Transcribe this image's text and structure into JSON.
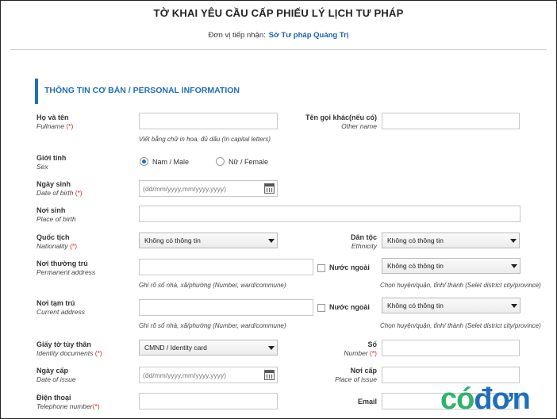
{
  "header": {
    "title": "TỜ KHAI YÊU CẦU CẤP PHIẾU LÝ LỊCH TƯ PHÁP",
    "unit_label": "Đơn vị tiếp nhận:",
    "unit_value": "Sở Tư pháp Quảng Trị"
  },
  "section": {
    "title": "THÔNG TIN CƠ BẢN / PERSONAL INFORMATION"
  },
  "fullname": {
    "label": "Họ và tên",
    "sub": "Fullname",
    "req": "(*)",
    "hint": "Viết bằng chữ in hoa, đủ dấu (In capital letters)"
  },
  "other_name": {
    "label": "Tên gọi khác(nếu có)",
    "sub": "Other name"
  },
  "sex": {
    "label": "Giới tính",
    "sub": "Sex",
    "male": "Nam / Male",
    "female": "Nữ / Female",
    "selected": "male"
  },
  "dob": {
    "label": "Ngày sinh",
    "sub": "Date of birth",
    "req": "(*)",
    "placeholder": "(dd/mm/yyyy,mm/yyyy,yyyy)"
  },
  "pob": {
    "label": "Nơi sinh",
    "sub": "Place of birth"
  },
  "nationality": {
    "label": "Quốc tịch",
    "sub": "Nationality",
    "req": "(*)",
    "value": "Không có thông tin"
  },
  "ethnicity": {
    "label": "Dân tộc",
    "sub": "Ethnicity",
    "value": "Không có thông tin"
  },
  "permanent": {
    "label": "Nơi thường trú",
    "sub": "Permanent address",
    "foreign": "Nước ngoài",
    "select": "Không có thông tin",
    "hint_left": "Ghi rõ số nhà, xã/phường (Number, ward/commune)",
    "hint_right": "Chọn huyện/quận, tỉnh/ thành (Selet district city/province)"
  },
  "current": {
    "label": "Nơi tạm trú",
    "sub": "Current address",
    "foreign": "Nước ngoài",
    "select": "Không có thông tin",
    "hint_left": "Ghi rõ số nhà, xã/phường (Number, ward/commune)",
    "hint_right": "Chọn huyện/quận, tỉnh/ thành (Selet district city/province)"
  },
  "id_doc": {
    "label": "Giấy tờ tùy thân",
    "sub": "Identity documents",
    "req": "(*)",
    "value": "CMND / Identity card"
  },
  "number": {
    "label": "Số",
    "sub": "Number",
    "req": "(*)"
  },
  "issue_date": {
    "label": "Ngày cấp",
    "sub": "Date of issue",
    "placeholder": "(dd/mm/yyyy,mm/yyyy,yyyy)"
  },
  "issue_place": {
    "label": "Nơi cấp",
    "sub": "Place of issue"
  },
  "phone": {
    "label": "Điện thoại",
    "sub": "Telephone number",
    "req": "(*)"
  },
  "email": {
    "label": "Email"
  },
  "watermark": {
    "part1": "có",
    "part2": "đơn",
    "color1": "#2fb36b",
    "color2": "#1f6fb8"
  }
}
